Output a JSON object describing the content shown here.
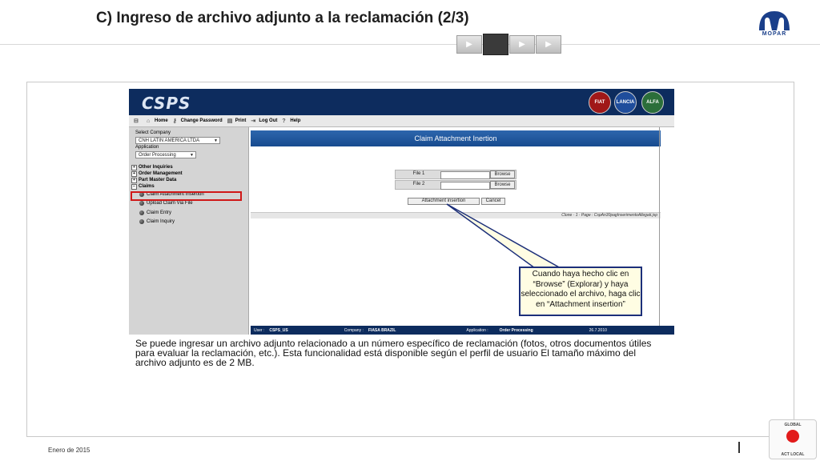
{
  "slide": {
    "title": "C) Ingreso de archivo adjunto a la reclamación (2/3)",
    "logo_text": "MOPAR",
    "progress_steps": 4,
    "active_step": 2,
    "description": "Se puede ingresar un archivo adjunto relacionado a un número específico de reclamación (fotos, otros documentos útiles para evaluar la reclamación, etc.). Esta funcionalidad está disponible según el perfil de usuario El tamaño máximo del archivo adjunto es de 2 MB.",
    "callout": "Cuando haya hecho clic en “Browse” (Explorar) y haya seleccionado el archivo, haga clic en “Attachment insertion”",
    "footer_date": "Enero de 2015",
    "badge": {
      "top": "GLOBAL",
      "bottom": "ACT LOCAL"
    }
  },
  "app": {
    "logo": "CSPS",
    "brands": [
      "FIAT",
      "LANCIA",
      "ALFA"
    ],
    "toolbar": {
      "home": "Home",
      "change_password": "Change Password",
      "print": "Print",
      "logout": "Log Out",
      "help": "Help"
    },
    "left": {
      "select_company_label": "Select Company",
      "company_value": "CNH LATIN AMERICA LTDA",
      "application_label": "Application",
      "application_value": "Order Processing",
      "menu": [
        "Other Inquiries",
        "Order Management",
        "Part Master Data",
        "Claims"
      ],
      "claims_items": [
        "Claim Attachment Insertion",
        "Upload Claim Via File",
        "Claim Entry",
        "Claim Inquiry"
      ]
    },
    "main": {
      "header": "Claim Attachment Inertion",
      "file1_label": "File 1",
      "file2_label": "File 2",
      "browse_label": "Browse",
      "attach_button": "Attachment insertion",
      "cancel_button": "Cancel",
      "status_text": "Clone  ·  1 · Page : CspAn30pagInserimentoAllegati.jsp"
    },
    "footer": {
      "user_label": "User :",
      "user_value": "CSPS_US",
      "company_label": "Company :",
      "company_value": "FIASA BRAZIL",
      "application_label": "Application :",
      "application_value": "Order Processing",
      "date": "26.7.2010"
    }
  },
  "colors": {
    "banner": "#0d2c5e",
    "header_bar": "#2d66ad",
    "highlight": "#d01818",
    "callout_border": "#1c2f7a"
  }
}
